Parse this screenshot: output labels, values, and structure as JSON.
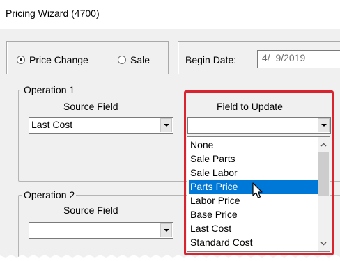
{
  "window": {
    "title": "Pricing Wizard (4700)"
  },
  "mode": {
    "options": [
      {
        "label": "Price Change",
        "selected": true
      },
      {
        "label": "Sale",
        "selected": false
      }
    ]
  },
  "begin_date": {
    "label": "Begin Date:",
    "value": "4/  9/2019"
  },
  "operation1": {
    "legend": "Operation 1",
    "source_label": "Source Field",
    "source_value": "Last Cost",
    "update_label": "Field to Update",
    "update_value": ""
  },
  "operation2": {
    "legend": "Operation 2",
    "source_label": "Source Field",
    "source_value": ""
  },
  "dropdown": {
    "items": [
      "None",
      "Sale Parts",
      "Sale Labor",
      "Parts Price",
      "Labor Price",
      "Base Price",
      "Last Cost",
      "Standard Cost"
    ],
    "highlighted": "Parts Price"
  },
  "colors": {
    "highlight": "#0078d7",
    "callout": "#d9232f"
  },
  "icons": [
    "chevron-down-icon",
    "scroll-up-icon",
    "scroll-down-icon",
    "mouse-pointer-icon"
  ]
}
